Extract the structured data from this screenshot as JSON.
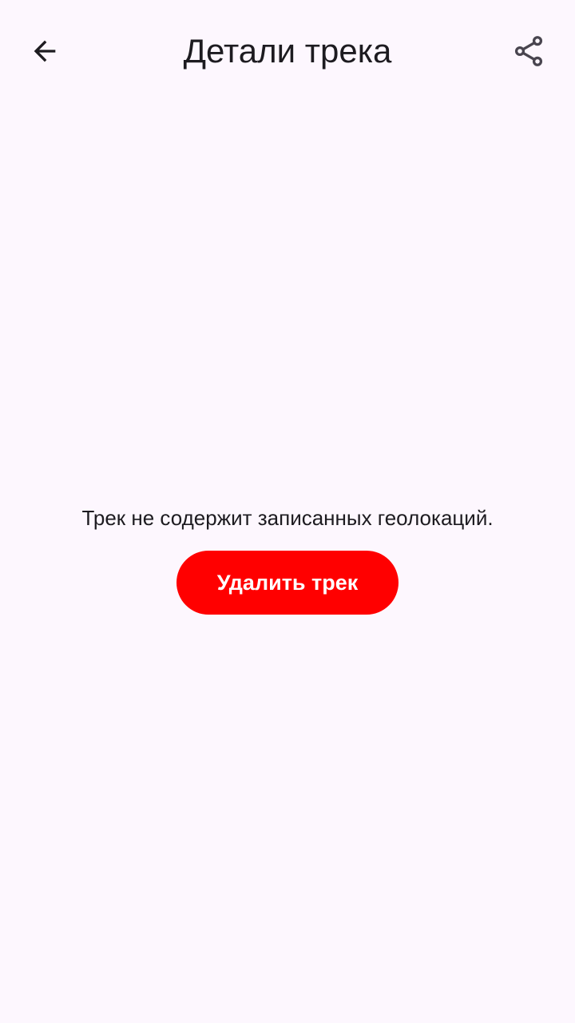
{
  "header": {
    "title": "Детали трека",
    "back_icon": "arrow-back-icon",
    "share_icon": "share-icon"
  },
  "main": {
    "empty_message": "Трек не содержит записанных геолокаций.",
    "delete_button_label": "Удалить трек"
  },
  "colors": {
    "background": "#FDF7FE",
    "text": "#1D1B20",
    "delete_button": "#FF0000",
    "delete_button_text": "#FFFFFF",
    "icon": "#1D1B20",
    "share_icon": "#49454F"
  }
}
